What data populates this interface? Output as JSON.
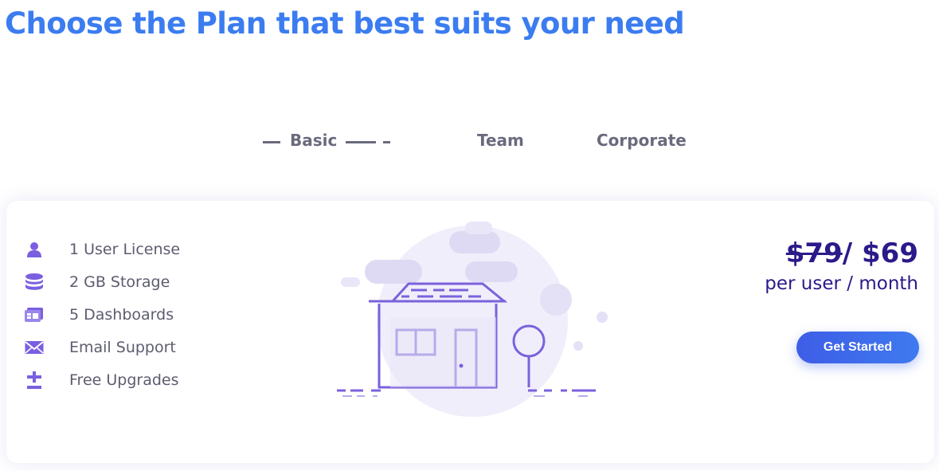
{
  "header": {
    "title": "Choose the Plan that best suits your need"
  },
  "tabs": [
    {
      "label": "Basic",
      "active": true
    },
    {
      "label": "Team",
      "active": false
    },
    {
      "label": "Corporate",
      "active": false
    }
  ],
  "plan": {
    "features": [
      {
        "icon": "user-icon",
        "label": "1 User License"
      },
      {
        "icon": "database-icon",
        "label": "2 GB Storage"
      },
      {
        "icon": "dashboard-icon",
        "label": "5 Dashboards"
      },
      {
        "icon": "envelope-icon",
        "label": "Email Support"
      },
      {
        "icon": "plus-minus-icon",
        "label": "Free Upgrades"
      }
    ],
    "old_price": "$79",
    "price_separator": "/ ",
    "new_price": "$69",
    "period": "per user / month",
    "cta_label": "Get Started"
  },
  "colors": {
    "title": "#3b7cf0",
    "tab_text": "#6a6a7e",
    "feature_text": "#5c5c70",
    "icon": "#7b5fe0",
    "price": "#2a1a8a",
    "button": "#3e6cec"
  }
}
